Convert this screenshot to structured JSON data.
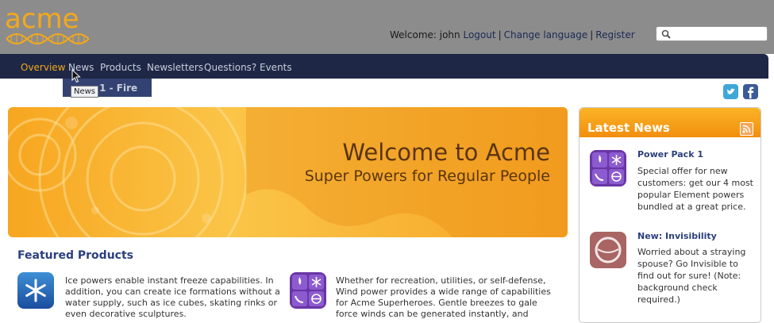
{
  "brand": {
    "logo_text": "acme"
  },
  "header": {
    "welcome_label": "Welcome: john",
    "links": [
      "Logout",
      "Change language",
      "Register"
    ]
  },
  "nav": {
    "items": [
      "Overview",
      "News",
      "Products",
      "Newsletters",
      "Questions?",
      "Events"
    ],
    "active": "Overview",
    "subbar_text": "r 1 - Fire",
    "tooltip": "News"
  },
  "banner": {
    "title": "Welcome to Acme",
    "subtitle": "Super Powers for Regular People"
  },
  "featured": {
    "title": "Featured Products",
    "products": [
      {
        "icon": "snowflake-icon",
        "text_lines": [
          "Ice powers enable instant freeze capabilities. In",
          "addition, you can create ice formations without a",
          "water supply, such as ice cubes, skating rinks or",
          "even decorative sculptures."
        ]
      },
      {
        "icon": "element-powers-icon",
        "text_lines": [
          "Whether for recreation, utilities, or self-defense,",
          "Wind power provides a wide range of capabilities",
          "for Acme Superheroes. Gentle breezes to gale",
          "force winds can be generated instantly, and"
        ]
      }
    ]
  },
  "latest_news": {
    "title": "Latest News",
    "items": [
      {
        "icon": "element-powers-icon",
        "title": "Power Pack 1",
        "text_lines": [
          "Special offer for new",
          "customers: get our 4 most",
          "popular Element powers",
          "bundled at a great price."
        ]
      },
      {
        "icon": "invisibility-icon",
        "title": "New: Invisibility",
        "text_lines": [
          "Worried about a straying",
          "spouse? Go Invisible to",
          "find out for sure! (Note:",
          "background check",
          "required.)"
        ]
      }
    ]
  },
  "colors": {
    "brand_orange": "#f3a91b",
    "nav_bg": "#1e2746",
    "header_bg": "#8c8c8c",
    "link": "#2b3f7d"
  }
}
